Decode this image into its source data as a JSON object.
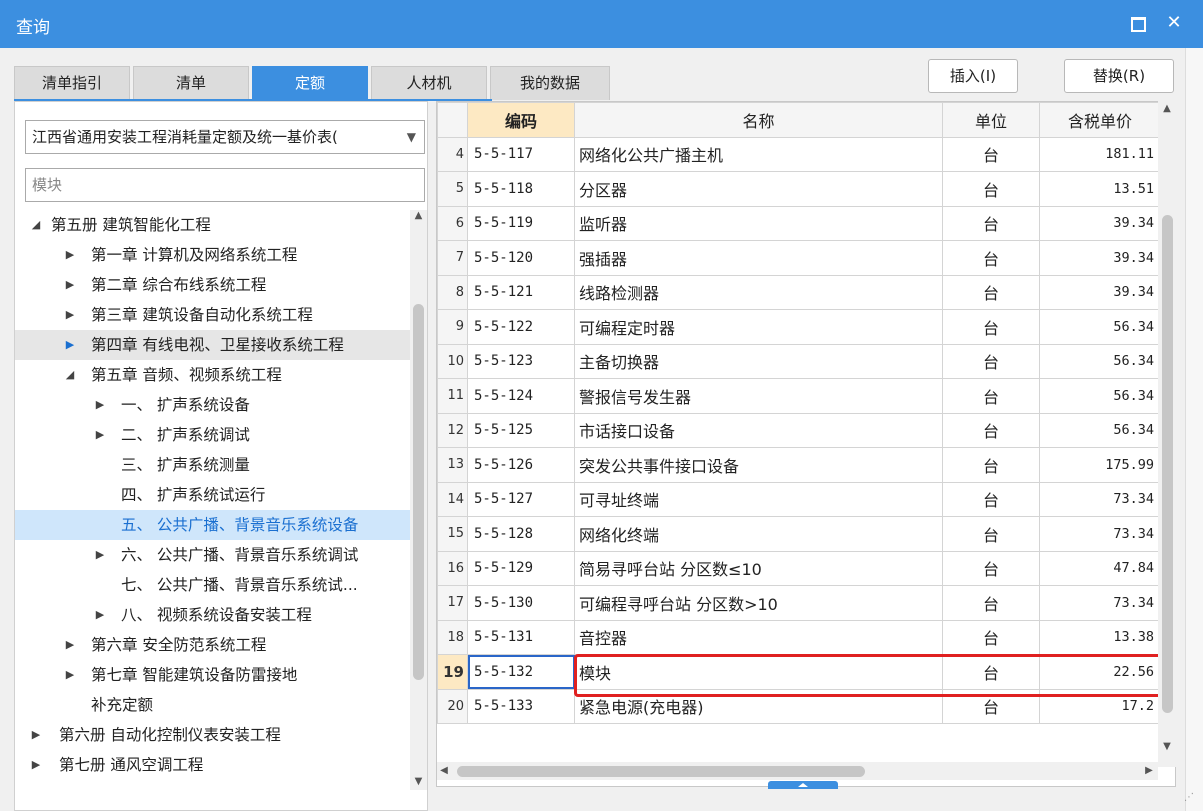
{
  "window": {
    "title": "查询",
    "maximize_glyph": "",
    "close_glyph": "✕"
  },
  "tabs": [
    "清单指引",
    "清单",
    "定额",
    "人材机",
    "我的数据"
  ],
  "active_tab": "定额",
  "actions": {
    "insert": "插入(I)",
    "replace": "替换(R)"
  },
  "library_select": "江西省通用安装工程消耗量定额及统一基价表(",
  "search": {
    "placeholder": "模块",
    "value": ""
  },
  "tree": [
    {
      "label": "第五册 建筑智能化工程",
      "state": "expanded"
    },
    {
      "label": "第一章 计算机及网络系统工程",
      "state": "collapsed"
    },
    {
      "label": "第二章 综合布线系统工程",
      "state": "collapsed"
    },
    {
      "label": "第三章 建筑设备自动化系统工程",
      "state": "collapsed"
    },
    {
      "label": "第四章 有线电视、卫星接收系统工程",
      "state": "collapsed"
    },
    {
      "label": "第五章 音频、视频系统工程",
      "state": "expanded"
    },
    {
      "label": "一、 扩声系统设备",
      "state": "collapsed"
    },
    {
      "label": "二、 扩声系统调试",
      "state": "collapsed"
    },
    {
      "label": "三、 扩声系统测量",
      "state": "leaf"
    },
    {
      "label": "四、 扩声系统试运行",
      "state": "leaf"
    },
    {
      "label": "五、 公共广播、背景音乐系统设备",
      "state": "leaf"
    },
    {
      "label": "六、 公共广播、背景音乐系统调试",
      "state": "collapsed"
    },
    {
      "label": "七、 公共广播、背景音乐系统试...",
      "state": "leaf"
    },
    {
      "label": "八、 视频系统设备安装工程",
      "state": "collapsed"
    },
    {
      "label": "第六章 安全防范系统工程",
      "state": "collapsed"
    },
    {
      "label": "第七章 智能建筑设备防雷接地",
      "state": "collapsed"
    },
    {
      "label": "补充定额",
      "state": "leaf"
    },
    {
      "label": "第六册 自动化控制仪表安装工程",
      "state": "collapsed"
    },
    {
      "label": "第七册 通风空调工程",
      "state": "collapsed"
    }
  ],
  "tree_selected_label": "五、 公共广播、背景音乐系统设备",
  "tree_hovered_label": "第四章 有线电视、卫星接收系统工程",
  "table": {
    "headers": {
      "code": "编码",
      "name": "名称",
      "unit": "单位",
      "price": "含税单价"
    },
    "rows": [
      {
        "num": "4",
        "code": "5-5-117",
        "name": "网络化公共广播主机",
        "unit": "台",
        "price": "181.11"
      },
      {
        "num": "5",
        "code": "5-5-118",
        "name": "分区器",
        "unit": "台",
        "price": "13.51"
      },
      {
        "num": "6",
        "code": "5-5-119",
        "name": "监听器",
        "unit": "台",
        "price": "39.34"
      },
      {
        "num": "7",
        "code": "5-5-120",
        "name": "强插器",
        "unit": "台",
        "price": "39.34"
      },
      {
        "num": "8",
        "code": "5-5-121",
        "name": "线路检测器",
        "unit": "台",
        "price": "39.34"
      },
      {
        "num": "9",
        "code": "5-5-122",
        "name": "可编程定时器",
        "unit": "台",
        "price": "56.34"
      },
      {
        "num": "10",
        "code": "5-5-123",
        "name": "主备切换器",
        "unit": "台",
        "price": "56.34"
      },
      {
        "num": "11",
        "code": "5-5-124",
        "name": "警报信号发生器",
        "unit": "台",
        "price": "56.34"
      },
      {
        "num": "12",
        "code": "5-5-125",
        "name": "市话接口设备",
        "unit": "台",
        "price": "56.34"
      },
      {
        "num": "13",
        "code": "5-5-126",
        "name": "突发公共事件接口设备",
        "unit": "台",
        "price": "175.99"
      },
      {
        "num": "14",
        "code": "5-5-127",
        "name": "可寻址终端",
        "unit": "台",
        "price": "73.34"
      },
      {
        "num": "15",
        "code": "5-5-128",
        "name": "网络化终端",
        "unit": "台",
        "price": "73.34"
      },
      {
        "num": "16",
        "code": "5-5-129",
        "name": "简易寻呼台站 分区数≤10",
        "unit": "台",
        "price": "47.84"
      },
      {
        "num": "17",
        "code": "5-5-130",
        "name": "可编程寻呼台站 分区数>10",
        "unit": "台",
        "price": "73.34"
      },
      {
        "num": "18",
        "code": "5-5-131",
        "name": "音控器",
        "unit": "台",
        "price": "13.38"
      },
      {
        "num": "19",
        "code": "5-5-132",
        "name": "模块",
        "unit": "台",
        "price": "22.56"
      },
      {
        "num": "20",
        "code": "5-5-133",
        "name": "紧急电源(充电器)",
        "unit": "台",
        "price": "17.2"
      }
    ],
    "current_row_num": "19"
  },
  "colors": {
    "accent": "#3c8fe0",
    "highlight": "#e02020",
    "header_code_bg": "#fde9c3",
    "selected_tree_bg": "#cfe6fb"
  }
}
